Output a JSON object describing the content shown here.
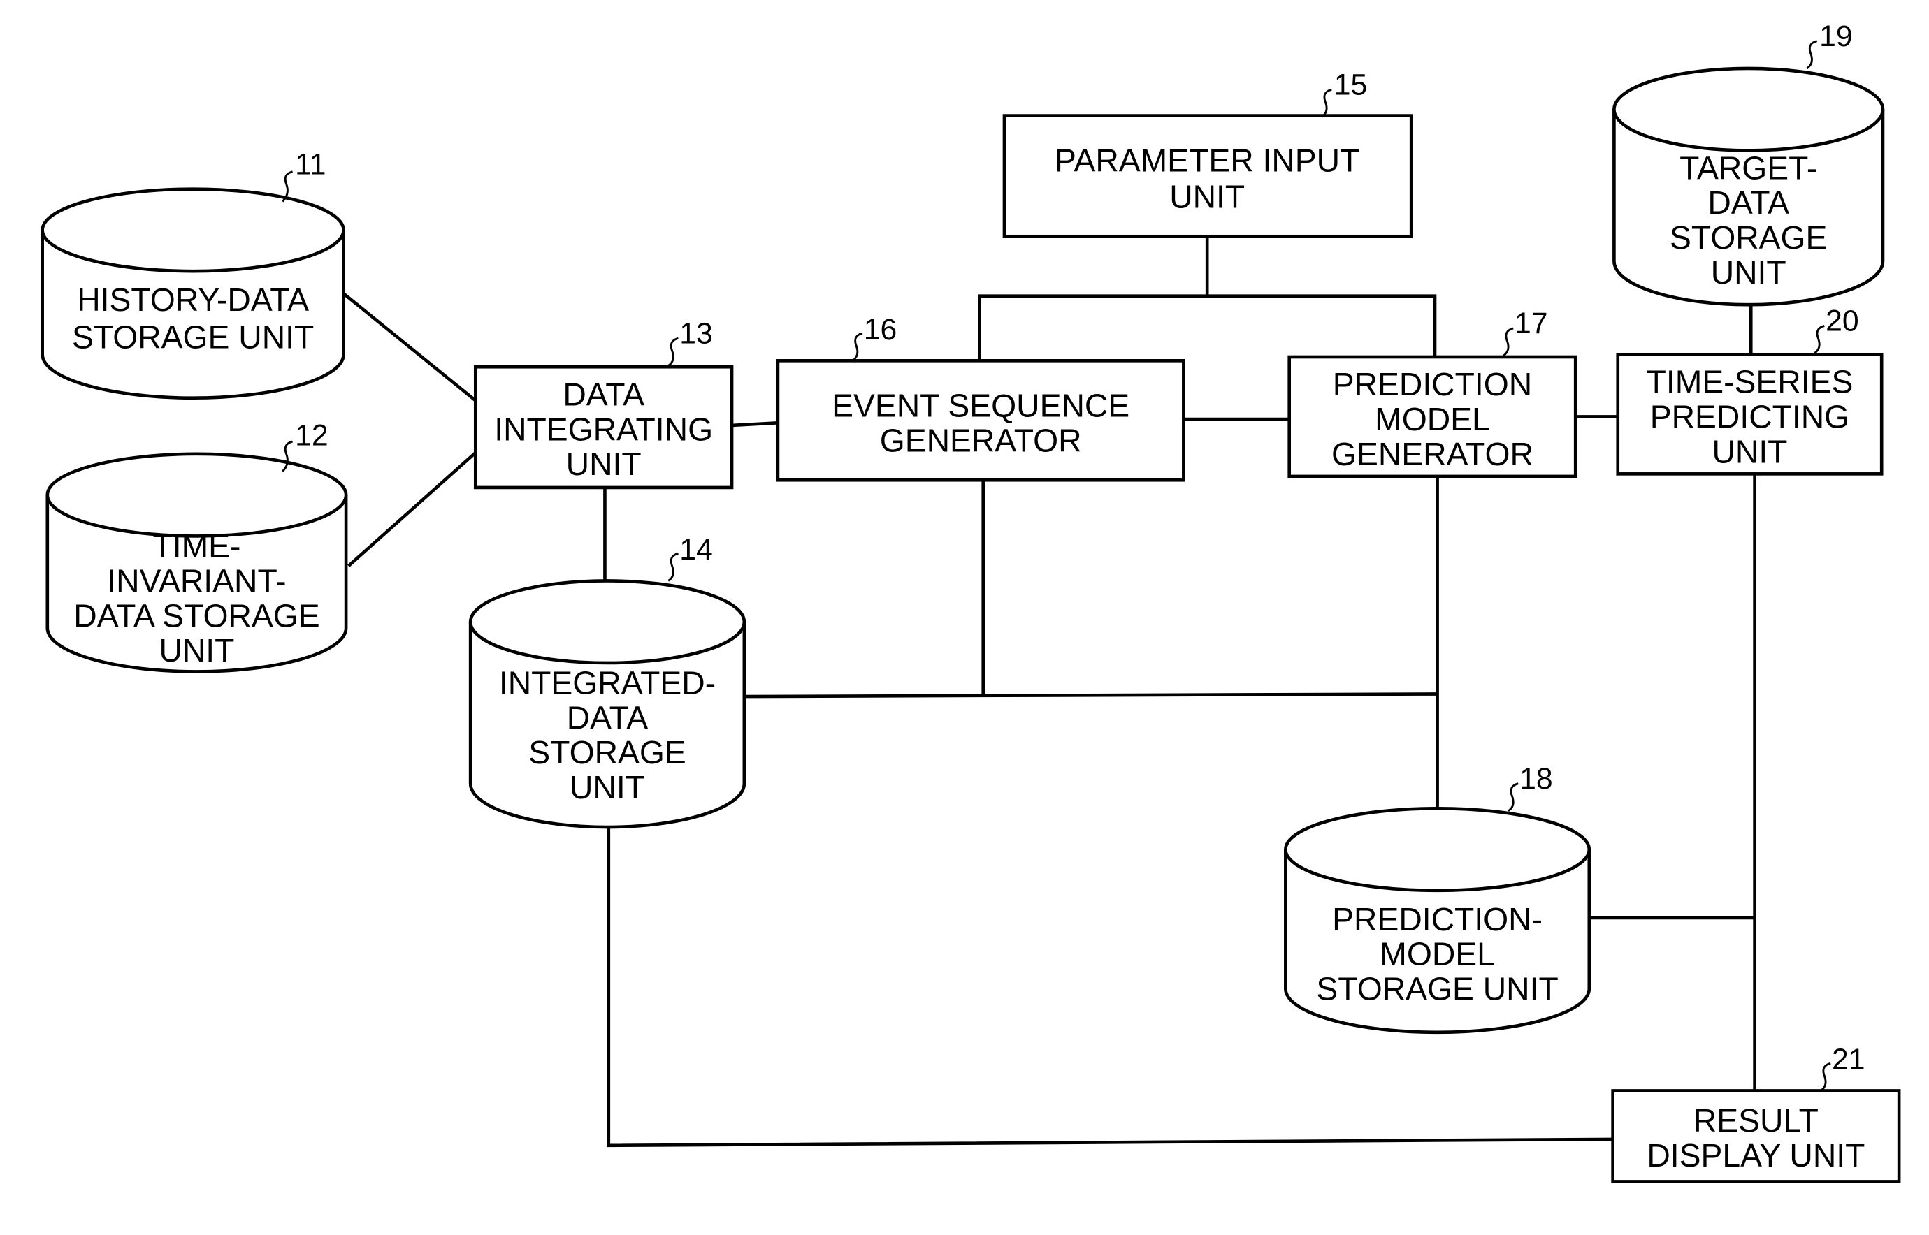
{
  "diagram": {
    "nodes": {
      "n11": {
        "ref": "11",
        "shape": "cylinder",
        "lines": [
          "HISTORY-DATA",
          "STORAGE UNIT"
        ]
      },
      "n12": {
        "ref": "12",
        "shape": "cylinder",
        "lines": [
          "TIME-",
          "INVARIANT-",
          "DATA STORAGE",
          "UNIT"
        ]
      },
      "n13": {
        "ref": "13",
        "shape": "box",
        "lines": [
          "DATA",
          "INTEGRATING",
          "UNIT"
        ]
      },
      "n14": {
        "ref": "14",
        "shape": "cylinder",
        "lines": [
          "INTEGRATED-",
          "DATA",
          "STORAGE",
          "UNIT"
        ]
      },
      "n15": {
        "ref": "15",
        "shape": "box",
        "lines": [
          "PARAMETER INPUT",
          "UNIT"
        ]
      },
      "n16": {
        "ref": "16",
        "shape": "box",
        "lines": [
          "EVENT SEQUENCE",
          "GENERATOR"
        ]
      },
      "n17": {
        "ref": "17",
        "shape": "box",
        "lines": [
          "PREDICTION",
          "MODEL",
          "GENERATOR"
        ]
      },
      "n18": {
        "ref": "18",
        "shape": "cylinder",
        "lines": [
          "PREDICTION-",
          "MODEL",
          "STORAGE UNIT"
        ]
      },
      "n19": {
        "ref": "19",
        "shape": "cylinder",
        "lines": [
          "TARGET-",
          "DATA",
          "STORAGE",
          "UNIT"
        ]
      },
      "n20": {
        "ref": "20",
        "shape": "box",
        "lines": [
          "TIME-SERIES",
          "PREDICTING",
          "UNIT"
        ]
      },
      "n21": {
        "ref": "21",
        "shape": "box",
        "lines": [
          "RESULT",
          "DISPLAY UNIT"
        ]
      }
    },
    "edges": [
      [
        "11",
        "13"
      ],
      [
        "12",
        "13"
      ],
      [
        "13",
        "16"
      ],
      [
        "13",
        "14"
      ],
      [
        "15",
        "16"
      ],
      [
        "15",
        "17"
      ],
      [
        "16",
        "17"
      ],
      [
        "17",
        "20"
      ],
      [
        "19",
        "20"
      ],
      [
        "16",
        "14"
      ],
      [
        "17",
        "14"
      ],
      [
        "17",
        "18"
      ],
      [
        "18",
        "20"
      ],
      [
        "20",
        "21"
      ],
      [
        "14",
        "21"
      ]
    ]
  }
}
